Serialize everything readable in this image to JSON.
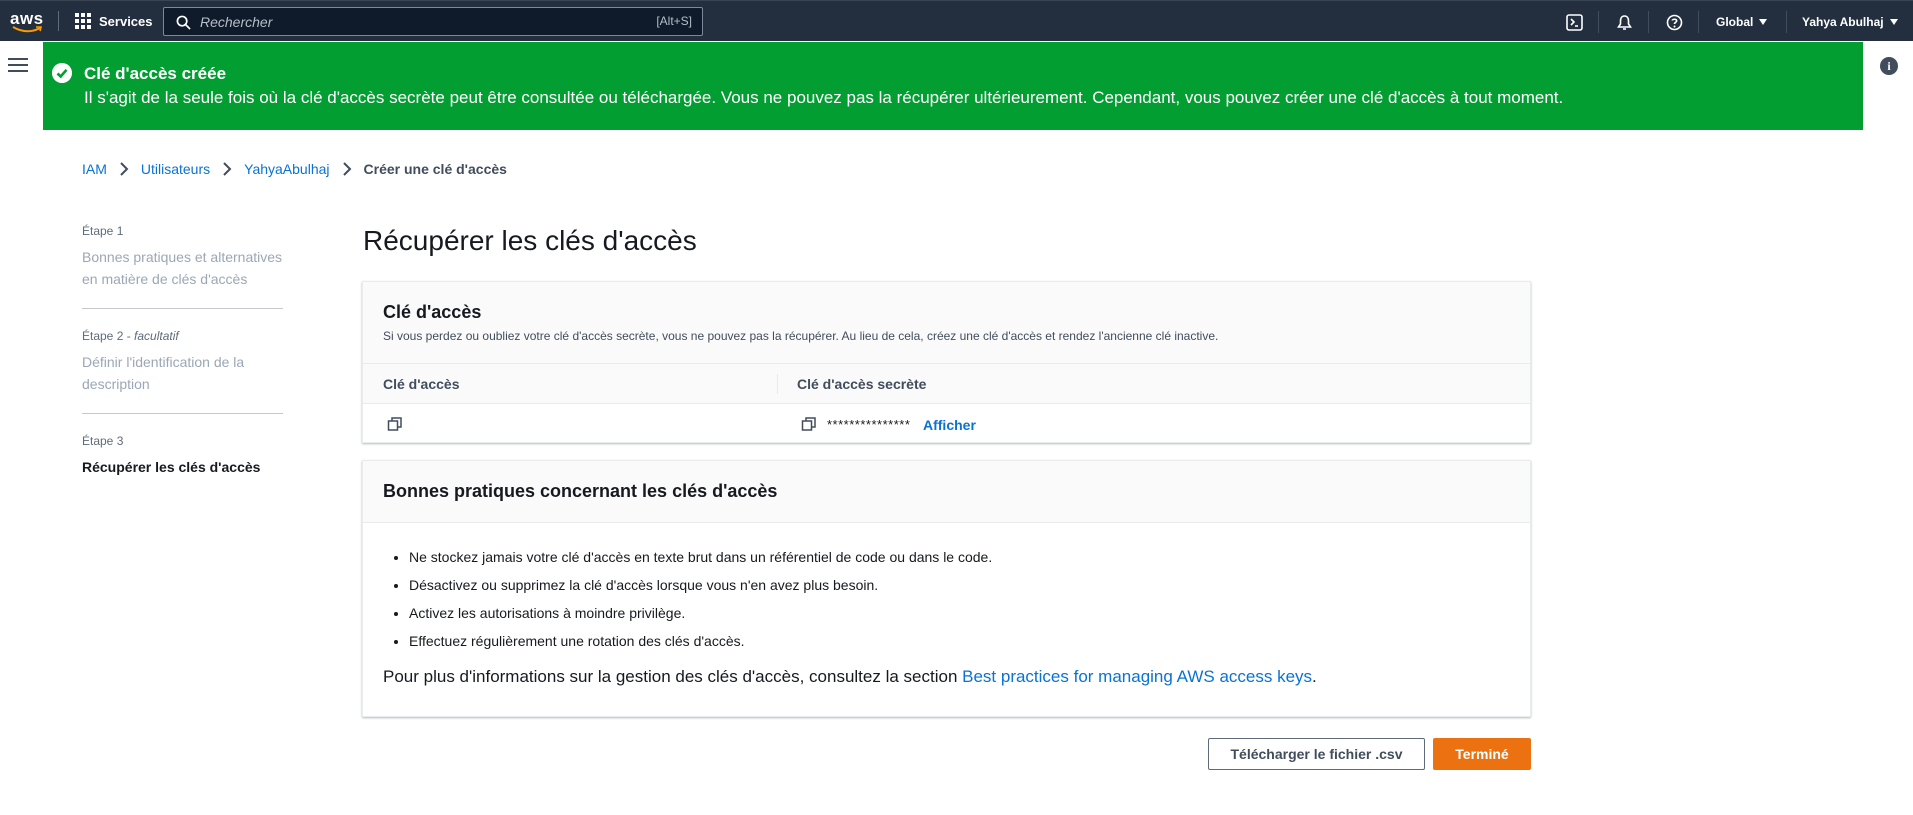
{
  "topnav": {
    "logo": "aws",
    "services_label": "Services",
    "search_placeholder": "Rechercher",
    "search_shortcut": "[Alt+S]",
    "region_label": "Global",
    "user_label": "Yahya Abulhaj",
    "icons": [
      "cloudshell-icon",
      "bell-icon",
      "help-icon"
    ]
  },
  "flash": {
    "title": "Clé d'accès créée",
    "message": "Il s'agit de la seule fois où la clé d'accès secrète peut être consultée ou téléchargée. Vous ne pouvez pas la récupérer ultérieurement. Cependant, vous pouvez créer une clé d'accès à tout moment.",
    "color": "#029e32"
  },
  "breadcrumb": {
    "items": [
      "IAM",
      "Utilisateurs",
      "YahyaAbulhaj"
    ],
    "current": "Créer une clé d'accès"
  },
  "steps": [
    {
      "label": "Étape 1",
      "optional": "",
      "title": "Bonnes pratiques et alternatives en matière de clés d'accès"
    },
    {
      "label": "Étape 2 - ",
      "optional": "facultatif",
      "title": "Définir l'identification de la description"
    },
    {
      "label": "Étape 3",
      "optional": "",
      "title": "Récupérer les clés d'accès"
    }
  ],
  "main": {
    "title": "Récupérer les clés d'accès",
    "access_key_card": {
      "title": "Clé d'accès",
      "description": "Si vous perdez ou oubliez votre clé d'accès secrète, vous ne pouvez pas la récupérer. Au lieu de cela, créez une clé d'accès et rendez l'ancienne clé inactive.",
      "columns": [
        "Clé d'accès",
        "Clé d'accès secrète"
      ],
      "access_key_value": "",
      "secret_masked": "***************",
      "show_label": "Afficher"
    },
    "best_practices_card": {
      "title": "Bonnes pratiques concernant les clés d'accès",
      "items": [
        "Ne stockez jamais votre clé d'accès en texte brut dans un référentiel de code ou dans le code.",
        "Désactivez ou supprimez la clé d'accès lorsque vous n'en avez plus besoin.",
        "Activez les autorisations à moindre privilège.",
        "Effectuez régulièrement une rotation des clés d'accès."
      ],
      "more_info_prefix": "Pour plus d'informations sur la gestion des clés d'accès, consultez la section ",
      "more_info_link": "Best practices for managing AWS access keys",
      "more_info_suffix": "."
    },
    "buttons": {
      "download": "Télécharger le fichier .csv",
      "done": "Terminé"
    }
  },
  "colors": {
    "nav_bg": "#232f3e",
    "link": "#0972d3",
    "primary_button": "#ec7211"
  }
}
